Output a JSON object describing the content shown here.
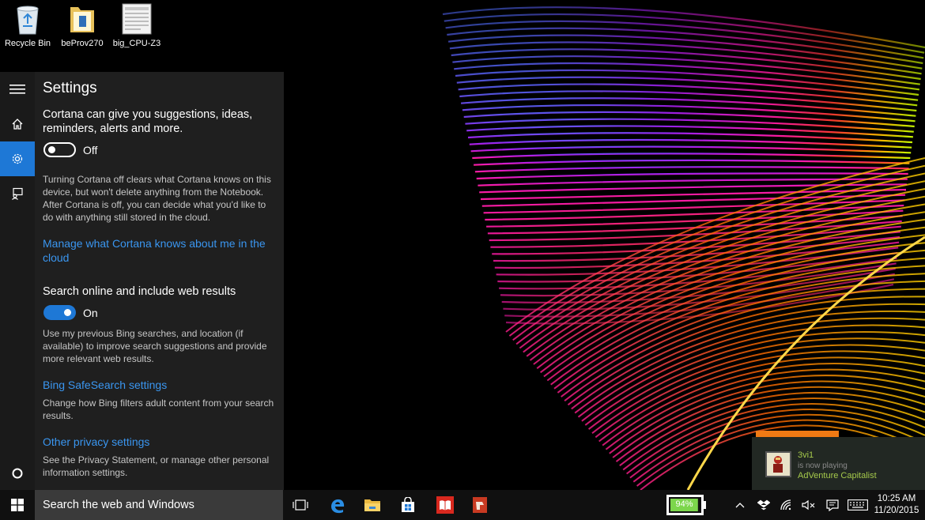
{
  "desktop": {
    "icons": [
      {
        "label": "Recycle Bin",
        "icon": "recycle-bin-icon"
      },
      {
        "label": "beProv270",
        "icon": "folder-icon"
      },
      {
        "label": "big_CPU-Z3",
        "icon": "image-file-icon"
      }
    ]
  },
  "cortana": {
    "title": "Settings",
    "rail": {
      "menu_icon": "hamburger-menu-icon",
      "home_icon": "home-icon",
      "settings_icon": "gear-icon",
      "feedback_icon": "feedback-icon",
      "cortana_icon": "cortana-circle-icon"
    },
    "suggestions_heading": "Cortana can give you suggestions, ideas, reminders, alerts and more.",
    "suggestions_toggle_label": "Off",
    "suggestions_toggle_state": false,
    "suggestions_desc": "Turning Cortana off clears what Cortana knows on this device, but won't delete anything from the Notebook. After Cortana is off, you can decide what you'd like to do with anything still stored in the cloud.",
    "manage_link": "Manage what Cortana knows about me in the cloud",
    "web_heading": "Search online and include web results",
    "web_toggle_label": "On",
    "web_toggle_state": true,
    "web_desc": "Use my previous Bing searches, and location (if available) to improve search suggestions and provide more relevant web results.",
    "safesearch_link": "Bing SafeSearch settings",
    "safesearch_desc": "Change how Bing filters adult content from your search results.",
    "privacy_link": "Other privacy settings",
    "privacy_desc": "See the Privacy Statement, or manage other personal information settings."
  },
  "taskbar": {
    "search_placeholder": "Search the web and Windows",
    "apps": [
      "task-view-icon",
      "edge-icon",
      "file-explorer-icon",
      "store-icon",
      "reader-icon",
      "app-icon"
    ],
    "battery_percent": "94%",
    "battery_level": 0.94,
    "time": "10:25 AM",
    "date": "11/20/2015"
  },
  "notification": {
    "user": "3vi1",
    "status": "is now playing",
    "game": "AdVenture Capitalist"
  },
  "colors": {
    "accent": "#1e78d6",
    "link": "#3a96f0",
    "notif_orange": "#f07a14",
    "notif_green": "#a5c94b"
  }
}
